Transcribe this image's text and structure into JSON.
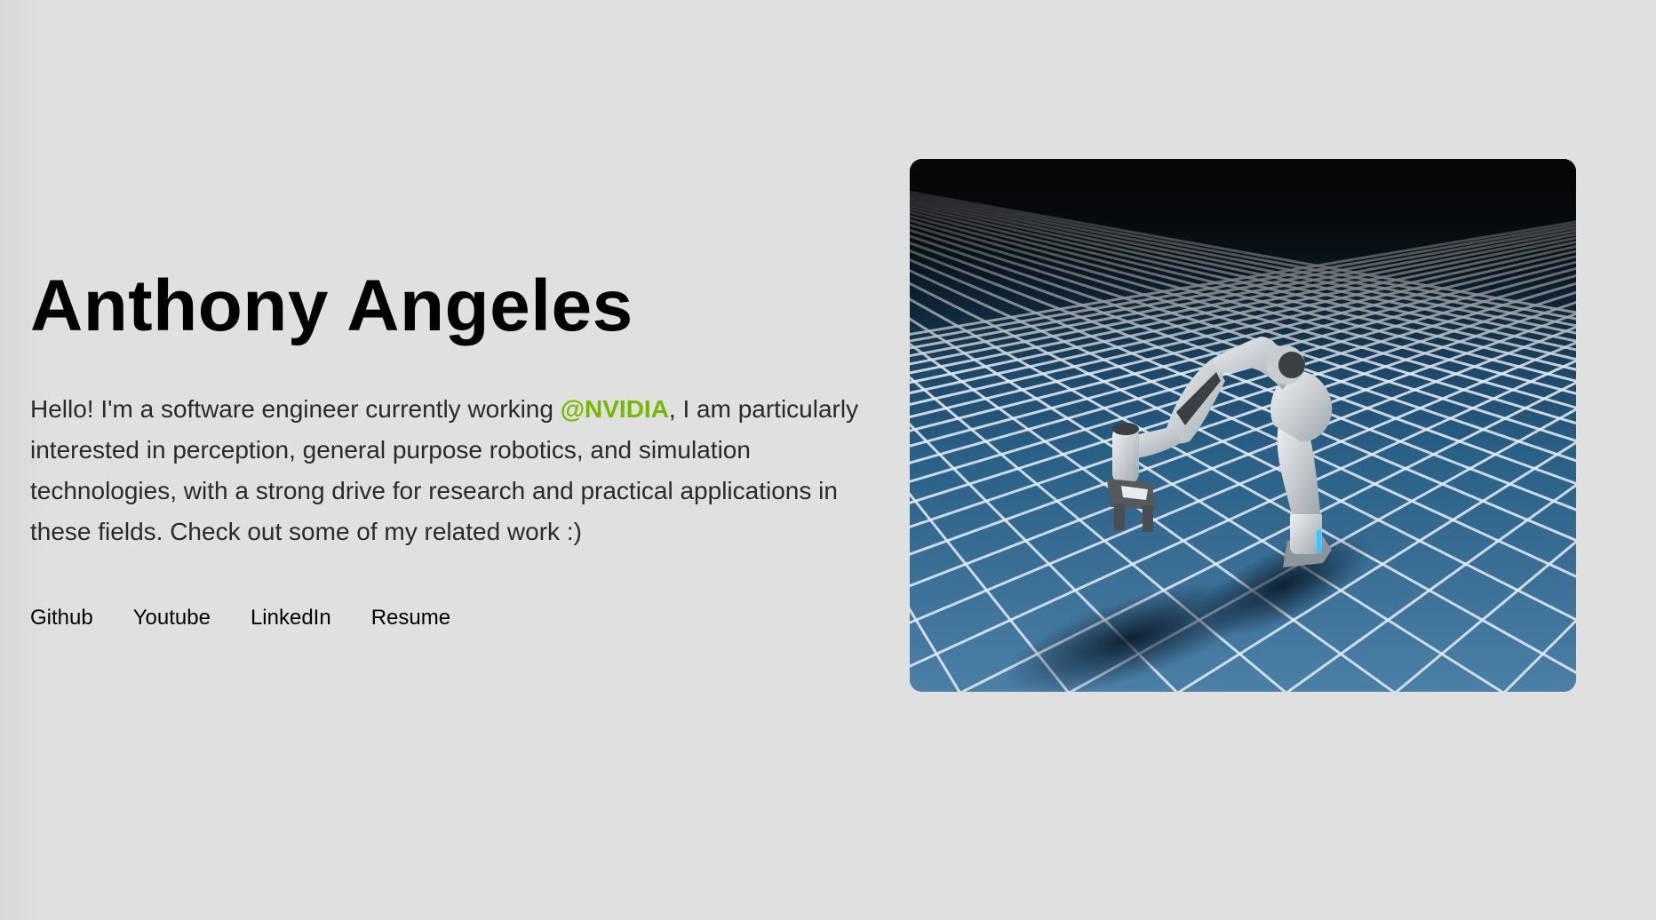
{
  "profile": {
    "name": "Anthony Angeles",
    "bio_before": "Hello! I'm a software engineer currently working ",
    "bio_highlight": "@NVIDIA",
    "bio_after": ", I am particularly interested in perception, general purpose robotics, and simulation technologies, with a strong drive for research and practical applications in these fields. Check out some of my related work :)"
  },
  "links": [
    {
      "label": "Github"
    },
    {
      "label": "Youtube"
    },
    {
      "label": "LinkedIn"
    },
    {
      "label": "Resume"
    }
  ],
  "media": {
    "description_icon": "robot-arm-image"
  },
  "colors": {
    "background": "#e0e0e0",
    "accent": "#76b900",
    "text": "#2a2a2a",
    "heading": "#000000"
  }
}
